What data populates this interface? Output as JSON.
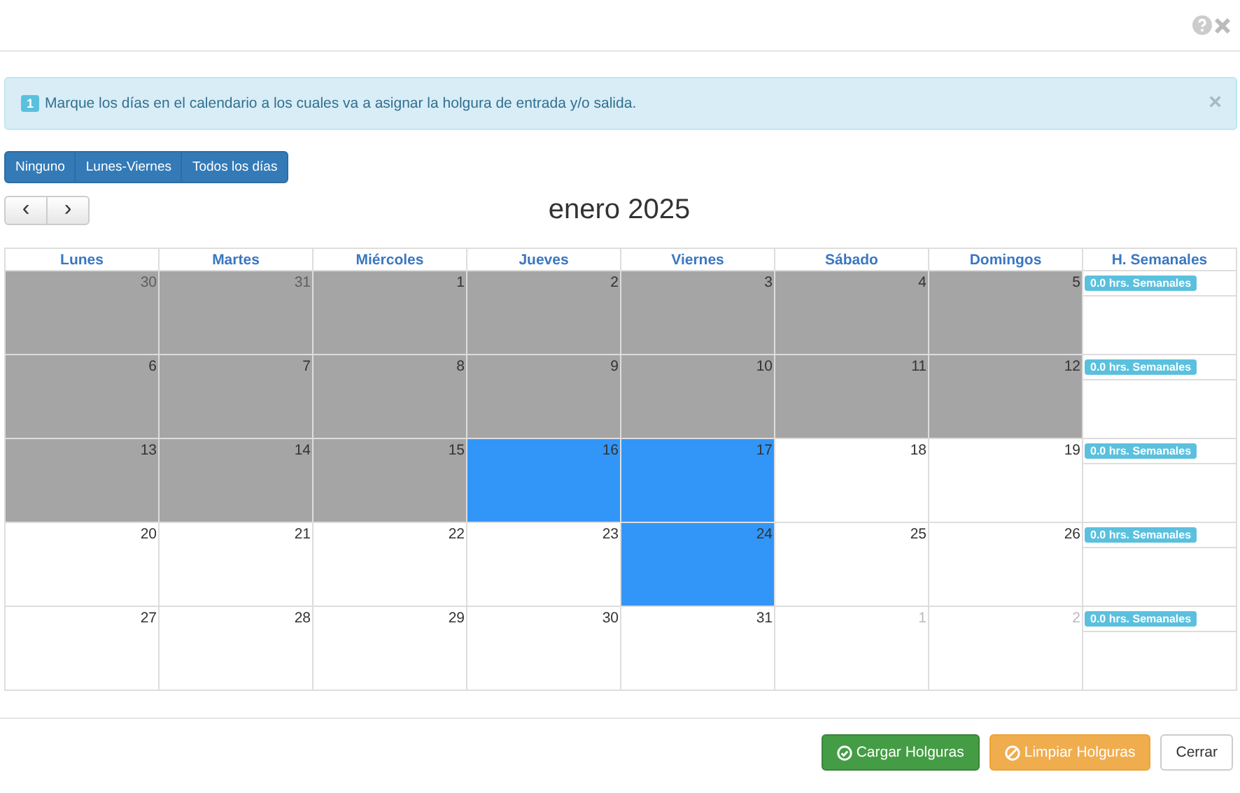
{
  "alert": {
    "badge": "1",
    "text": "Marque los días en el calendario a los cuales va a asignar la holgura de entrada y/o salida.",
    "close": "×"
  },
  "quick_select": [
    "Ninguno",
    "Lunes-Viernes",
    "Todos los días"
  ],
  "nav": [
    "‹",
    "›"
  ],
  "title": "enero 2025",
  "columns": [
    "Lunes",
    "Martes",
    "Miércoles",
    "Jueves",
    "Viernes",
    "Sábado",
    "Domingos",
    "H. Semanales"
  ],
  "weeks": [
    {
      "days": [
        {
          "day": "30",
          "past": true,
          "selected": false,
          "outside": true
        },
        {
          "day": "31",
          "past": true,
          "selected": false,
          "outside": true
        },
        {
          "day": "1",
          "past": true,
          "selected": false,
          "outside": false
        },
        {
          "day": "2",
          "past": true,
          "selected": false,
          "outside": false
        },
        {
          "day": "3",
          "past": true,
          "selected": false,
          "outside": false
        },
        {
          "day": "4",
          "past": true,
          "selected": false,
          "outside": false
        },
        {
          "day": "5",
          "past": true,
          "selected": false,
          "outside": false
        }
      ],
      "hours": "0.0 hrs. Semanales"
    },
    {
      "days": [
        {
          "day": "6",
          "past": true,
          "selected": false,
          "outside": false
        },
        {
          "day": "7",
          "past": true,
          "selected": false,
          "outside": false
        },
        {
          "day": "8",
          "past": true,
          "selected": false,
          "outside": false
        },
        {
          "day": "9",
          "past": true,
          "selected": false,
          "outside": false
        },
        {
          "day": "10",
          "past": true,
          "selected": false,
          "outside": false
        },
        {
          "day": "11",
          "past": true,
          "selected": false,
          "outside": false
        },
        {
          "day": "12",
          "past": true,
          "selected": false,
          "outside": false
        }
      ],
      "hours": "0.0 hrs. Semanales"
    },
    {
      "days": [
        {
          "day": "13",
          "past": true,
          "selected": false,
          "outside": false
        },
        {
          "day": "14",
          "past": true,
          "selected": false,
          "outside": false
        },
        {
          "day": "15",
          "past": true,
          "selected": false,
          "outside": false
        },
        {
          "day": "16",
          "past": false,
          "selected": true,
          "outside": false
        },
        {
          "day": "17",
          "past": false,
          "selected": true,
          "outside": false
        },
        {
          "day": "18",
          "past": false,
          "selected": false,
          "outside": false
        },
        {
          "day": "19",
          "past": false,
          "selected": false,
          "outside": false
        }
      ],
      "hours": "0.0 hrs. Semanales"
    },
    {
      "days": [
        {
          "day": "20",
          "past": false,
          "selected": false,
          "outside": false
        },
        {
          "day": "21",
          "past": false,
          "selected": false,
          "outside": false
        },
        {
          "day": "22",
          "past": false,
          "selected": false,
          "outside": false
        },
        {
          "day": "23",
          "past": false,
          "selected": false,
          "outside": false
        },
        {
          "day": "24",
          "past": false,
          "selected": true,
          "outside": false
        },
        {
          "day": "25",
          "past": false,
          "selected": false,
          "outside": false
        },
        {
          "day": "26",
          "past": false,
          "selected": false,
          "outside": false
        }
      ],
      "hours": "0.0 hrs. Semanales"
    },
    {
      "days": [
        {
          "day": "27",
          "past": false,
          "selected": false,
          "outside": false
        },
        {
          "day": "28",
          "past": false,
          "selected": false,
          "outside": false
        },
        {
          "day": "29",
          "past": false,
          "selected": false,
          "outside": false
        },
        {
          "day": "30",
          "past": false,
          "selected": false,
          "outside": false
        },
        {
          "day": "31",
          "past": false,
          "selected": false,
          "outside": false
        },
        {
          "day": "1",
          "past": false,
          "selected": false,
          "outside": true
        },
        {
          "day": "2",
          "past": false,
          "selected": false,
          "outside": true
        }
      ],
      "hours": "0.0 hrs. Semanales"
    }
  ],
  "footer_buttons": [
    {
      "label": "Cargar Holguras",
      "kind": "success"
    },
    {
      "label": "Limpiar Holguras",
      "kind": "warning"
    },
    {
      "label": "Cerrar",
      "kind": "default"
    }
  ]
}
